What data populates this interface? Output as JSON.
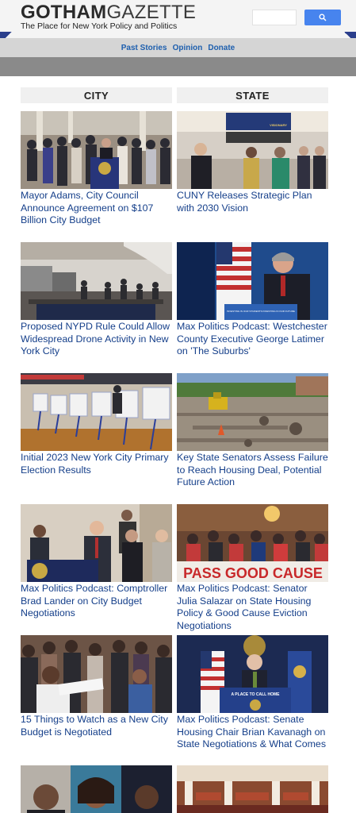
{
  "header": {
    "logo_bold": "GOTHAM",
    "logo_light": "GAZETTE",
    "tagline": "The Place for New York Policy and Politics",
    "search_placeholder": ""
  },
  "nav": {
    "items": [
      "Past Stories",
      "Opinion",
      "Donate"
    ]
  },
  "columns": {
    "city_label": "CITY",
    "state_label": "STATE"
  },
  "city_stories": [
    {
      "headline": "Mayor Adams, City Council Announce Agreement on $107 Billion City Budget"
    },
    {
      "headline": "Proposed NYPD Rule Could Allow Widespread Drone Activity in New York City"
    },
    {
      "headline": "Initial 2023 New York City Primary Election Results"
    },
    {
      "headline": "Max Politics Podcast: Comptroller Brad Lander on City Budget Negotiations"
    },
    {
      "headline": "15 Things to Watch as a New City Budget is Negotiated"
    },
    {
      "headline": ""
    }
  ],
  "state_stories": [
    {
      "headline": "CUNY Releases Strategic Plan with 2030 Vision"
    },
    {
      "headline": "Max Politics Podcast: Westchester County Executive George Latimer on 'The Suburbs'"
    },
    {
      "headline": "Key State Senators Assess Failure to Reach Housing Deal, Potential Future Action"
    },
    {
      "headline": "Max Politics Podcast: Senator Julia Salazar on State Housing Policy & Good Cause Eviction Negotiations"
    },
    {
      "headline": "Max Politics Podcast: Senate Housing Chair Brian Kavanagh on State Negotiations & What Comes"
    },
    {
      "headline": ""
    }
  ],
  "photo_text": {
    "cuny_banner": "VISIONARY",
    "latimer_podium": "INVESTING IN OUR STUDENTS INVESTING IN OUR FUTURE",
    "salazar_sign": "PASS GOOD CAUSE",
    "kavanagh_podium": "A PLACE TO CALL HOME"
  },
  "colors": {
    "link": "#153f8a",
    "nav_link": "#1e5fae",
    "search_button": "#4784ee",
    "nav_bar": "#d5d5d5",
    "sub_bar": "#8a8a8a"
  }
}
